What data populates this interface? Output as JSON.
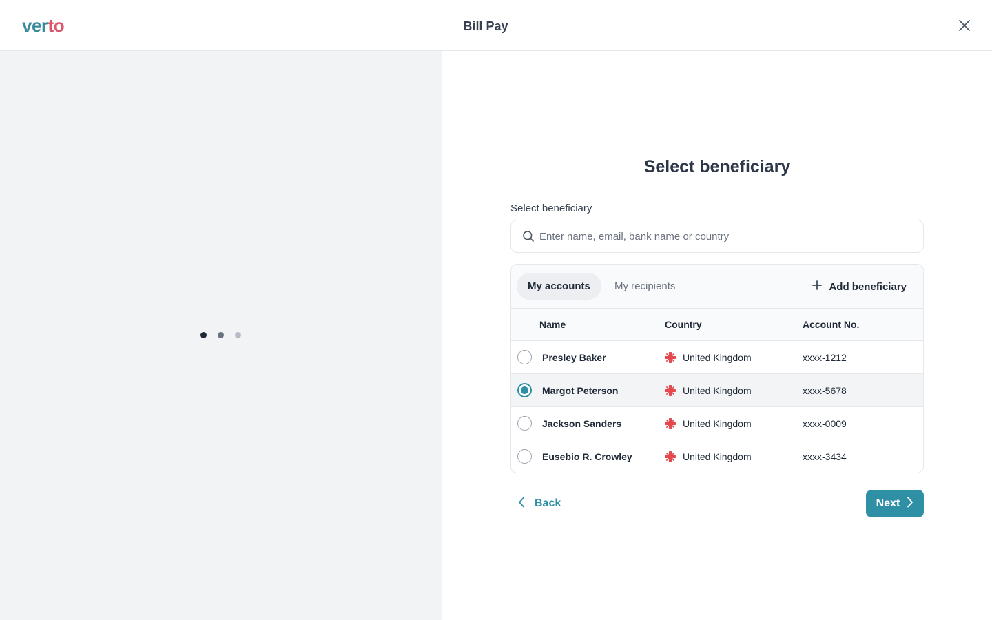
{
  "header": {
    "logo_part1": "ver",
    "logo_part2": "to",
    "title": "Bill Pay",
    "close_icon": "close-icon"
  },
  "loader": {
    "dot_colors": [
      "#1f2937",
      "#6b7280",
      "#b6bcc5"
    ]
  },
  "main": {
    "title": "Select beneficiary",
    "search": {
      "label": "Select beneficiary",
      "placeholder": "Enter name, email, bank name or country",
      "value": ""
    },
    "tabs": [
      {
        "label": "My accounts",
        "active": true
      },
      {
        "label": "My recipients",
        "active": false
      }
    ],
    "add_beneficiary_label": "Add beneficiary",
    "table": {
      "columns": [
        "Name",
        "Country",
        "Account No."
      ],
      "rows": [
        {
          "name": "Presley Baker",
          "country": "United Kingdom",
          "account": "xxxx-1212",
          "selected": false
        },
        {
          "name": "Margot Peterson",
          "country": "United Kingdom",
          "account": "xxxx-5678",
          "selected": true
        },
        {
          "name": "Jackson Sanders",
          "country": "United Kingdom",
          "account": "xxxx-0009",
          "selected": false
        },
        {
          "name": "Eusebio R. Crowley",
          "country": "United Kingdom",
          "account": "xxxx-3434",
          "selected": false
        }
      ]
    },
    "back_label": "Back",
    "next_label": "Next"
  },
  "colors": {
    "accent": "#2f8fa5",
    "logo_teal": "#3b8b9e",
    "logo_red": "#d9566b"
  }
}
